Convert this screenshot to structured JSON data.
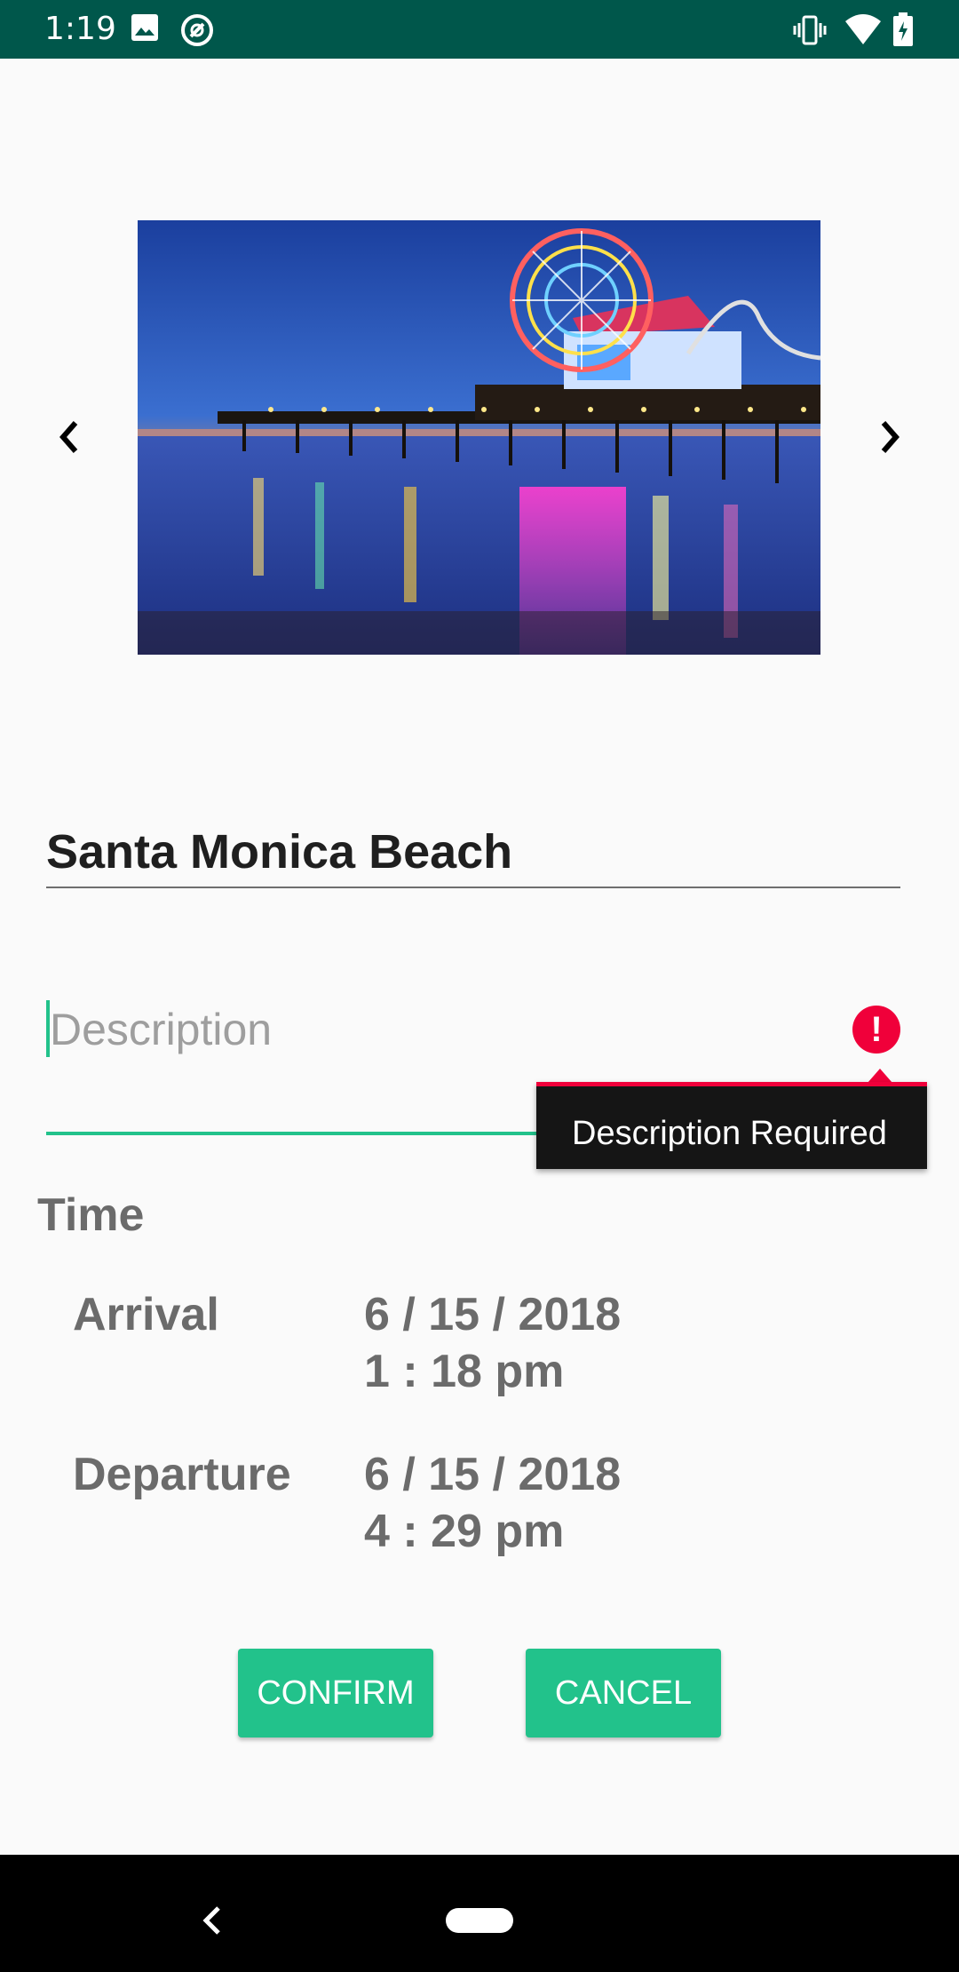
{
  "status_bar": {
    "time": "1:19",
    "icons": [
      "image-icon",
      "at-sign-icon",
      "vibrate-icon",
      "wifi-icon",
      "battery-charging-icon"
    ]
  },
  "carousel": {
    "prev_icon": "chevron-left-icon",
    "next_icon": "chevron-right-icon",
    "photo_subject": "Santa Monica pier with lit ferris wheel at dusk"
  },
  "form": {
    "title_value": "Santa Monica Beach",
    "description_placeholder": "Description",
    "error_message": "Description Required"
  },
  "time": {
    "section_label": "Time",
    "arrival_label": "Arrival",
    "arrival_date": "6 / 15 / 2018",
    "arrival_time": "1 : 18 pm",
    "departure_label": "Departure",
    "departure_date": "6 / 15 / 2018",
    "departure_time": "4 : 29 pm"
  },
  "buttons": {
    "confirm_label": "CONFIRM",
    "cancel_label": "CANCEL"
  },
  "colors": {
    "status_bar": "#00574b",
    "accent": "#22c28b",
    "error": "#f0003a",
    "label_gray": "#6b6b6b"
  }
}
